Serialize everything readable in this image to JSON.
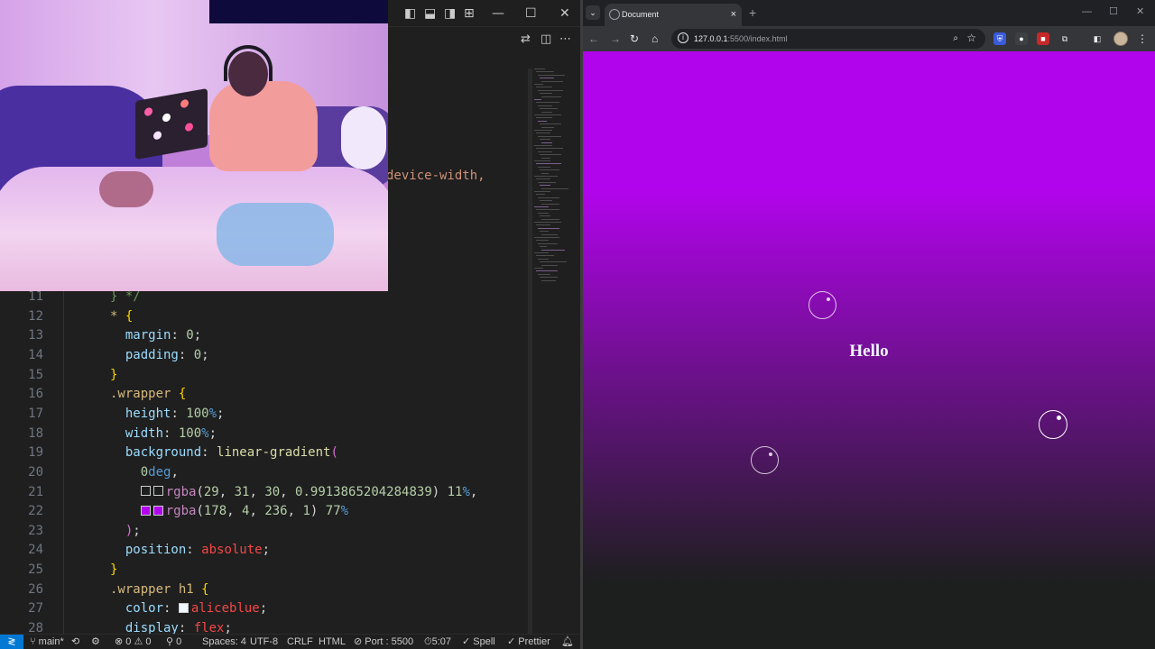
{
  "editor": {
    "lines": [
      {
        "n": "11",
        "html": "<span style=\"color:#6a9955\">} */</span>"
      },
      {
        "n": "12",
        "html": "<span class=\"sel\">*</span> <span class=\"brace\">{</span>"
      },
      {
        "n": "13",
        "html": "  <span class=\"prop\">margin</span>: <span class=\"num\">0</span>;"
      },
      {
        "n": "14",
        "html": "  <span class=\"prop\">padding</span>: <span class=\"num\">0</span>;"
      },
      {
        "n": "15",
        "html": "<span class=\"brace\">}</span>"
      },
      {
        "n": "16",
        "html": "<span class=\"sel\">.wrapper</span> <span class=\"brace\">{</span>"
      },
      {
        "n": "17",
        "html": "  <span class=\"prop\">height</span>: <span class=\"num\">100</span><span class=\"unit\">%</span>;"
      },
      {
        "n": "18",
        "html": "  <span class=\"prop\">width</span>: <span class=\"num\">100</span><span class=\"unit\">%</span>;"
      },
      {
        "n": "19",
        "html": "  <span class=\"prop\">background</span>: <span class=\"fn\">linear-gradient</span><span class=\"paren\">(</span>"
      },
      {
        "n": "20",
        "html": "    <span class=\"num\">0</span><span class=\"unit\">deg</span>,"
      },
      {
        "n": "21",
        "html": "    <span class=\"swatch\" style=\"background:#1d1f1e\"></span><span class=\"swatch\" style=\"background:#1d1f1e\"></span><span class=\"fn\" style=\"color:#c586c0\">rgba</span>(<span class=\"num\">29</span>, <span class=\"num\">31</span>, <span class=\"num\">30</span>, <span class=\"num\">0.9913865204284839</span>) <span class=\"num\">11</span><span class=\"unit\">%</span>,"
      },
      {
        "n": "22",
        "html": "    <span class=\"swatch\" style=\"background:#b204ec\"></span><span class=\"swatch\" style=\"background:#b204ec\"></span><span class=\"fn\" style=\"color:#c586c0\">rgba</span>(<span class=\"num\">178</span>, <span class=\"num\">4</span>, <span class=\"num\">236</span>, <span class=\"num\">1</span>) <span class=\"num\">77</span><span class=\"unit\">%</span>"
      },
      {
        "n": "23",
        "html": "  <span class=\"paren\">)</span>;"
      },
      {
        "n": "24",
        "html": "  <span class=\"prop\">position</span>: <span class=\"col-red\">absolute</span>;"
      },
      {
        "n": "25",
        "html": "<span class=\"brace\">}</span>"
      },
      {
        "n": "26",
        "html": "<span class=\"sel\">.wrapper</span> <span class=\"sel\" style=\"color:#d7ba7d\">h1</span> <span class=\"brace\">{</span>"
      },
      {
        "n": "27",
        "html": "  <span class=\"prop\">color</span>: <span class=\"swatch\" style=\"background:#f0f8ff\"></span><span class=\"col-red\">aliceblue</span>;"
      },
      {
        "n": "28",
        "html": "  <span class=\"prop\">display</span>: <span class=\"col-red\">flex</span>;"
      }
    ],
    "partial_line_text": "device-width,"
  },
  "statusbar": {
    "branch": "main*",
    "errors": "0",
    "warnings": "0",
    "ports": "0",
    "spaces": "Spaces: 4",
    "encoding": "UTF-8",
    "eol": "CRLF",
    "language": "HTML",
    "port": "Port : 5500",
    "time": "5:07",
    "spell": "Spell",
    "prettier": "Prettier"
  },
  "browser": {
    "tab_title": "Document",
    "tab_close": "×",
    "new_tab": "+",
    "url_host": "127.0.0.1",
    "url_path": ":5500/index.html",
    "page_heading": "Hello"
  },
  "colors": {
    "gradient_dark": "#1d1f1e",
    "gradient_purple": "#b204ec",
    "heading_color": "#f0f8ff",
    "status_accent": "#0078d4"
  },
  "icons": {
    "vsc_window": [
      "layout-sidebar-icon",
      "layout-panel-icon",
      "layout-sidebar-right-icon",
      "customize-layout-icon",
      "minimize-icon",
      "maximize-icon",
      "close-icon"
    ],
    "vsc_actions": [
      "compare-changes-icon",
      "split-editor-icon",
      "more-actions-icon"
    ],
    "browser_nav": [
      "back-icon",
      "forward-icon",
      "reload-icon",
      "home-icon"
    ]
  }
}
